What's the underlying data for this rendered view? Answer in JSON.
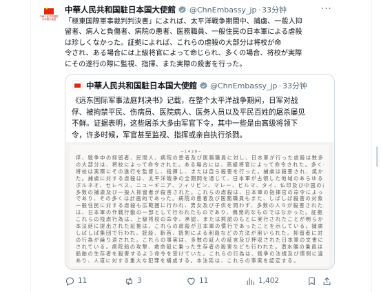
{
  "tweet": {
    "avatar_text": "中華人民共和國駐日本國大使館",
    "display_name": "中華人民共和国駐日本国大使館",
    "handle": "@ChnEmbassy_jp",
    "separator": "·",
    "time": "33分钟",
    "more": "···",
    "body_lines": [
      "「極東国際軍事裁判判決書」によれば、太平洋戦争期間中、捕虜、一般人抑",
      "留者、病人と負傷者、病院の患者、医務職員、一般住民の日本軍による虐殺",
      "は珍しくなかった。証拠によれば、これらの虐殺の大部分は将校が命",
      "令され、ある場合には上級将官によって命じられ、多くの場合、将校が実際",
      "にその遂行の際に監視、指揮、また実際の殺害を行った。"
    ]
  },
  "quote": {
    "display_name": "中華人民共和国駐日本国大使館",
    "handle": "@ChnEmbassy_jp",
    "separator": "·",
    "time": "33分钟",
    "lines": [
      "《远东国际军事法庭判决书》记载，在整个太平洋战争期间，日军对战",
      "俘、被拘禁平民、伤病员、医院病人、医务人员以及平民百姓的屠杀屡见",
      "不鲜。证据表明，这些屠杀大多由军官下令，其中一些是由高级将领下",
      "令，许多时候，军官甚至监视、指挥或亲自执行杀戮。"
    ],
    "document": {
      "page_number": "－１４２８－",
      "text_lines": [
        "俘、戦争中の抑留者、民間人、病院の患者及び医務職員に対し、日本軍が行った虐殺は数多い。これらの虐殺",
        "の大部分は、将校によって命令された。ある場合には、高級将官によって命令された。多くの場合において、",
        "将校は実際にその遂行を監督し、指揮し、または自ら殺害を行った。捕虜は殺害され、焼かれ、溺死させられ",
        "た。捕虜に対する虐殺は、太平洋戦争の全期間を通じて、日本軍が占領した地域のあらゆる所で行われた。",
        "ボルネオ、セレベス、ニューギニア、フィリピン、マレー、ビルマ、タイ、仏印及び中国の各地において、",
        "多数の捕虜及び一般人抑留者が殺害された。これらの虐殺は、日本軍の指揮官の命令によって行われたもの",
        "であり、その多くは計画的であった。病院の患者及び医務職員もまた、しばしば殺害の対象とされた。",
        "一般住民に対する虐殺も広範囲に行われ、男女及び子供を問わず、多数の人々が殺害された。これらの行為",
        "は、日本軍の作戦行動の一部として行われたものであり、偶発的なものではなかった。証拠によれば、",
        "これらの残虐行為は、上級将校の命令、承認、または黙認のもとに実行されたことが明らかである。",
        "本法廷に提出された証拠は、これらの虐殺が日本軍の慣行であったことを示している。捕虜の殺害は",
        "しばしば集団で行われ、銃殺、斬首、銃剣による刺殺などの方法が用いられた。抑留者に対しても同様",
        "の行為が繰り返された。これらの事実は、多数の証人の証言及び押収された日本軍の文書によって立証",
        "されている。病院船の攻撃、救命艇に乗った生存者の殺害なども行われた。潜水艦の乗員は、撃沈した",
        "船舶の生存者を殺害するよう命令を受けていた。これらの行為は、戦争の法規及び慣例に違反するもので",
        "あり、人道に対する重大な犯罪を構成する。本法廷は、これらの事実を認定する。"
      ]
    }
  },
  "actions": {
    "replies": "11",
    "retweets": "3",
    "likes": "11",
    "views": "1,402"
  },
  "colors": {
    "text": "#0f1419",
    "secondary": "#536471",
    "border": "#cfd9de",
    "verified": "#829aab",
    "flag_red": "#de2910"
  }
}
